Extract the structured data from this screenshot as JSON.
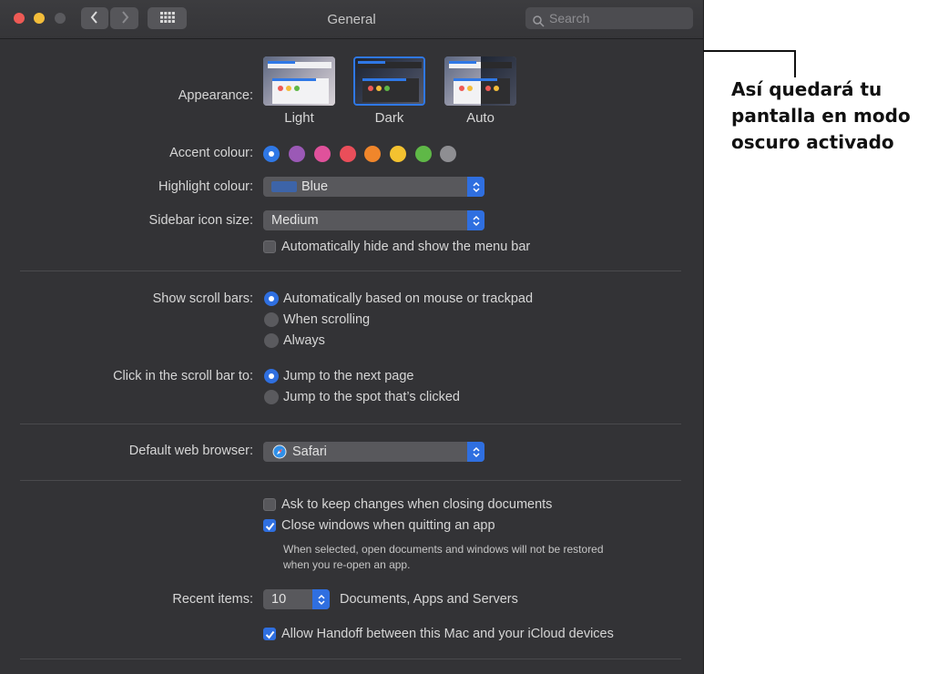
{
  "window": {
    "title": "General",
    "search_placeholder": "Search"
  },
  "appearance": {
    "label": "Appearance:",
    "options": [
      "Light",
      "Dark",
      "Auto"
    ],
    "selected": "Dark"
  },
  "accent": {
    "label": "Accent colour:",
    "colors": [
      "#2f78e6",
      "#9b59b6",
      "#e0519b",
      "#ea4e5a",
      "#f0862b",
      "#f4c230",
      "#5fb847",
      "#8e8e92"
    ],
    "selected_index": 0
  },
  "highlight": {
    "label": "Highlight colour:",
    "value": "Blue",
    "swatch_color": "#3d64a8"
  },
  "sidebar_icon": {
    "label": "Sidebar icon size:",
    "value": "Medium"
  },
  "menubar": {
    "label": "Automatically hide and show the menu bar",
    "checked": false
  },
  "scroll_bars": {
    "label": "Show scroll bars:",
    "options": [
      "Automatically based on mouse or trackpad",
      "When scrolling",
      "Always"
    ],
    "selected_index": 0
  },
  "click_scroll": {
    "label": "Click in the scroll bar to:",
    "options": [
      "Jump to the next page",
      "Jump to the spot that’s clicked"
    ],
    "selected_index": 0
  },
  "browser": {
    "label": "Default web browser:",
    "value": "Safari"
  },
  "ask_keep": {
    "label": "Ask to keep changes when closing documents",
    "checked": false
  },
  "close_windows": {
    "label": "Close windows when quitting an app",
    "checked": true,
    "note_line1": "When selected, open documents and windows will not be restored",
    "note_line2": "when you re-open an app."
  },
  "recent": {
    "label": "Recent items:",
    "value": "10",
    "suffix": "Documents, Apps and Servers"
  },
  "handoff": {
    "label": "Allow Handoff between this Mac and your iCloud devices",
    "checked": true
  },
  "annotation": {
    "line1": "Así quedará tu",
    "line2": "pantalla en modo",
    "line3": "oscuro activado"
  }
}
